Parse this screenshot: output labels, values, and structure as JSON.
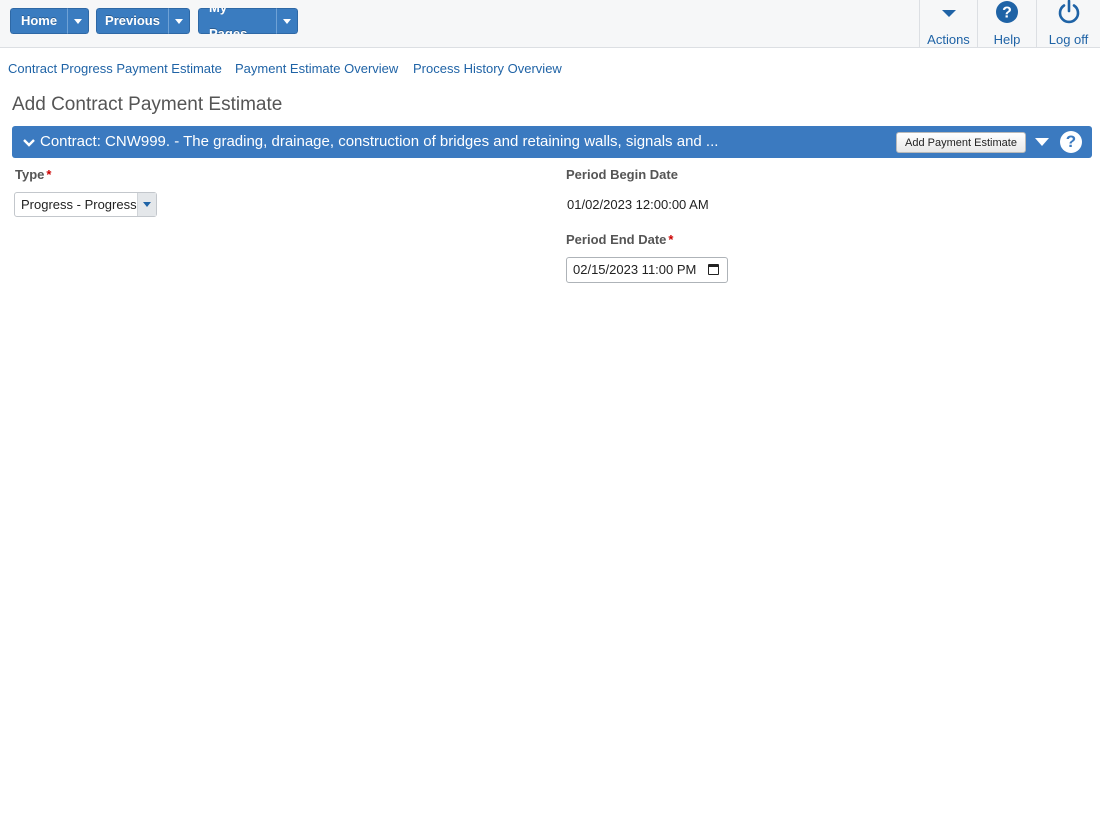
{
  "topnav": {
    "home_label": "Home",
    "previous_label": "Previous",
    "mypages_label": "My Pages",
    "actions_label": "Actions",
    "help_label": "Help",
    "logoff_label": "Log off"
  },
  "links": [
    "Contract Progress Payment Estimate",
    "Payment Estimate Overview",
    "Process History Overview"
  ],
  "page": {
    "title": "Add Contract Payment Estimate"
  },
  "panel": {
    "title": "Contract: CNW999. - The grading, drainage, construction of bridges and retaining walls, signals and ...",
    "add_button": "Add Payment Estimate",
    "help_glyph": "?"
  },
  "form": {
    "type_label": "Type",
    "type_value": "Progress - Progress",
    "begin_label": "Period Begin Date",
    "begin_value": "01/02/2023 12:00:00 AM",
    "end_label": "Period End Date",
    "end_value": "02/15/2023 11:00  PM",
    "required_mark": "*"
  },
  "colors": {
    "accent": "#3b7ac0",
    "link": "#1f63a6",
    "required": "#cc0000"
  }
}
